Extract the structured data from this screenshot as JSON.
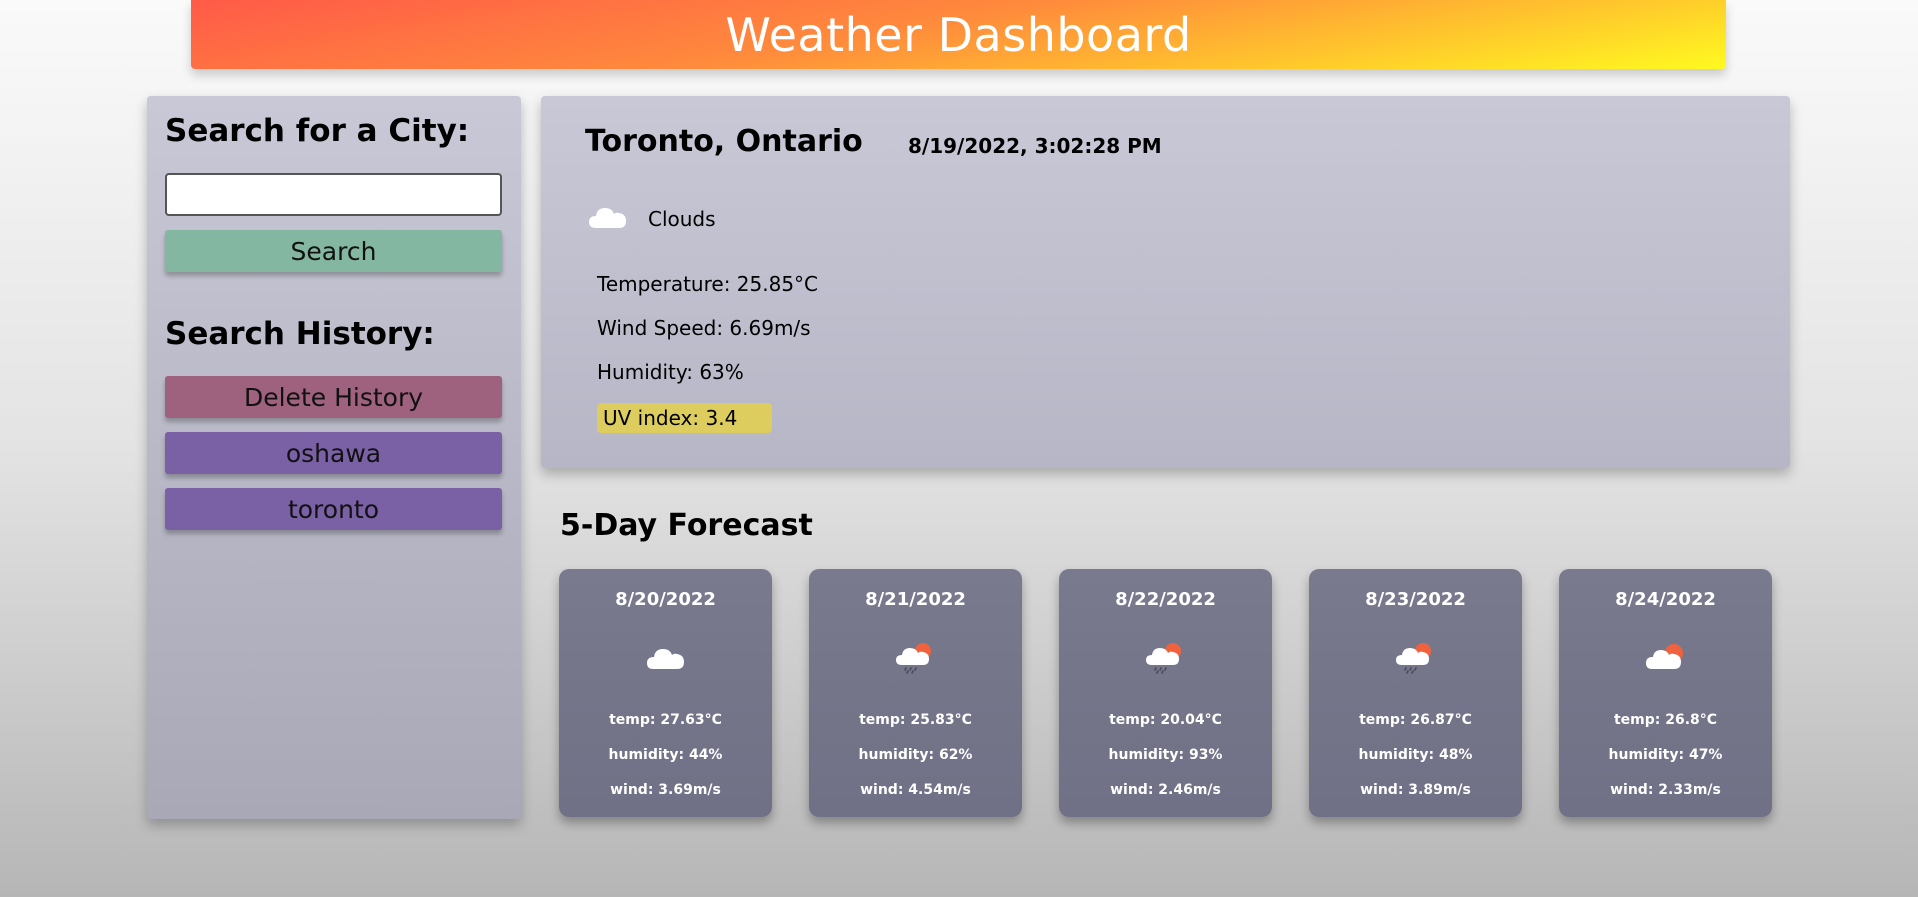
{
  "header": {
    "title": "Weather Dashboard",
    "gradient_colors": [
      "#ff5a48",
      "#ff8a3c",
      "#ffd02a",
      "#fffa20"
    ]
  },
  "sidebar": {
    "search_heading": "Search for a City:",
    "search_input": {
      "value": "",
      "placeholder": ""
    },
    "search_button": "Search",
    "history_heading": "Search History:",
    "delete_button": "Delete History",
    "history_items": [
      {
        "label": "oshawa"
      },
      {
        "label": "toronto"
      }
    ],
    "colors": {
      "search": "#84b7a1",
      "delete": "#9e617e",
      "history": "#7a61a6"
    }
  },
  "current": {
    "city": "Toronto, Ontario",
    "datetime": "8/19/2022, 3:02:28 PM",
    "condition": "Clouds",
    "condition_icon": "cloud-icon",
    "temperature": "Temperature: 25.85°C",
    "wind": "Wind Speed: 6.69m/s",
    "humidity": "Humidity: 63%",
    "uv": "UV index: 3.4",
    "uv_color": "#dccd5e"
  },
  "forecast": {
    "title": "5-Day Forecast",
    "days": [
      {
        "date": "8/20/2022",
        "icon": "cloud-icon",
        "temp": "temp: 27.63°C",
        "humidity": "humidity: 44%",
        "wind": "wind: 3.69m/s"
      },
      {
        "date": "8/21/2022",
        "icon": "sun-rain-cloud-icon",
        "temp": "temp: 25.83°C",
        "humidity": "humidity: 62%",
        "wind": "wind: 4.54m/s"
      },
      {
        "date": "8/22/2022",
        "icon": "sun-rain-cloud-icon",
        "temp": "temp: 20.04°C",
        "humidity": "humidity: 93%",
        "wind": "wind: 2.46m/s"
      },
      {
        "date": "8/23/2022",
        "icon": "sun-rain-cloud-icon",
        "temp": "temp: 26.87°C",
        "humidity": "humidity: 48%",
        "wind": "wind: 3.89m/s"
      },
      {
        "date": "8/24/2022",
        "icon": "sun-cloud-icon",
        "temp": "temp: 26.8°C",
        "humidity": "humidity: 47%",
        "wind": "wind: 2.33m/s"
      }
    ]
  }
}
